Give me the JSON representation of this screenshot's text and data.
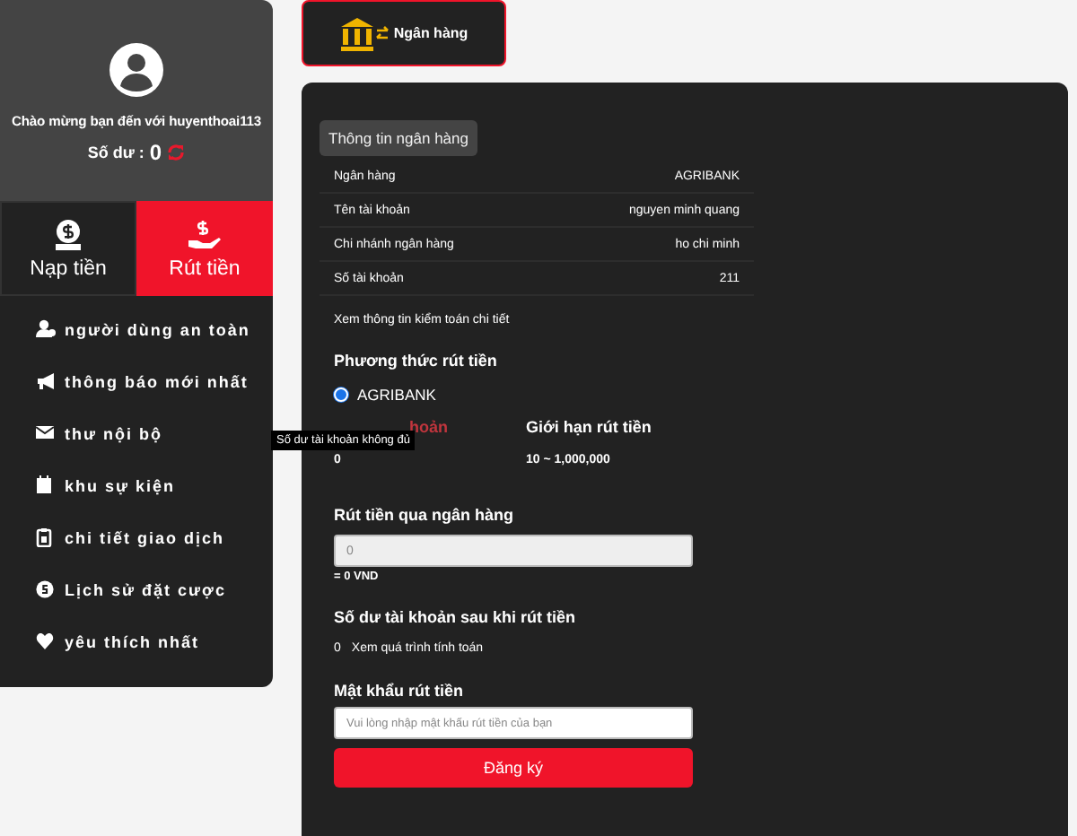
{
  "user": {
    "welcome": "Chào mừng bạn đến với huyenthoai113",
    "balance_label": "Số dư :",
    "balance": "0"
  },
  "actions": [
    {
      "label": "Nạp tiền",
      "kind": "deposit",
      "selected": false
    },
    {
      "label": "Rút tiền",
      "kind": "withdraw",
      "selected": true
    }
  ],
  "menu": [
    {
      "label": "người dùng an toàn",
      "kind": "user"
    },
    {
      "label": "thông báo mới nhất",
      "kind": "megaphone"
    },
    {
      "label": "thư nội bộ",
      "kind": "mail"
    },
    {
      "label": "khu sự kiện",
      "kind": "calendar"
    },
    {
      "label": "chi tiết giao dịch",
      "kind": "clipboard"
    },
    {
      "label": "Lịch sử đặt cược",
      "kind": "coin"
    },
    {
      "label": "yêu thích nhất",
      "kind": "heart"
    }
  ],
  "tab": {
    "label": "Ngân hàng",
    "selected": true
  },
  "bank_info": {
    "title": "Thông tin ngân hàng",
    "rows": [
      {
        "label": "Ngân hàng",
        "value": "AGRIBANK"
      },
      {
        "label": "Tên tài khoản",
        "value": "nguyen minh quang"
      },
      {
        "label": "Chi nhánh ngân hàng",
        "value": "ho chi minh"
      },
      {
        "label": "Số tài khoản",
        "value": "211"
      }
    ],
    "link": "Xem thông tin kiểm toán chi tiết"
  },
  "method": {
    "title": "Phương thức rút tiền",
    "options": [
      {
        "label": "AGRIBANK",
        "selected": true
      }
    ]
  },
  "balance_col": {
    "label": "hoản",
    "value": "0"
  },
  "limit_col": {
    "label": "Giới hạn rút tiền",
    "value": "10 ~ 1,000,000"
  },
  "tooltip": "Số dư tài khoản không đủ",
  "amount": {
    "label": "Rút tiền qua ngân hàng",
    "placeholder": "0",
    "note": "= 0 VND"
  },
  "after": {
    "label": "Số dư tài khoản sau khi rút tiền",
    "value": "0",
    "link": "Xem quá trình tính toán"
  },
  "password": {
    "label": "Mật khẩu rút tiền",
    "placeholder": "Vui lòng nhập mật khẩu rút tiền của bạn"
  },
  "submit": "Đăng ký"
}
